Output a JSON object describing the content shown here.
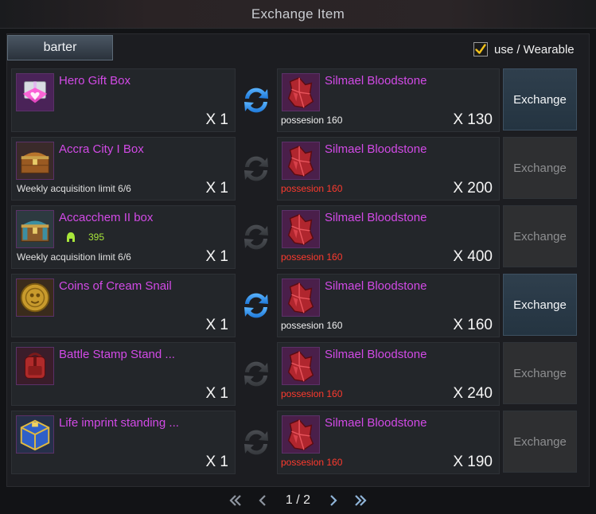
{
  "window": {
    "title": "Exchange Item"
  },
  "tab": {
    "label": "barter"
  },
  "filter": {
    "label": "use / Wearable",
    "checked": true
  },
  "colors": {
    "item_name": "#d24ae6",
    "possession_ok": "#f0f0f0",
    "possession_insufficient": "#ff3a2e",
    "bonus_value": "#a8e63a",
    "checkmark": "#f2c21b"
  },
  "rows": [
    {
      "give": {
        "name": "Hero Gift Box",
        "qty": "X 1",
        "limit": "",
        "bonus": "",
        "icon": "gift-box-icon"
      },
      "swap_active": true,
      "get": {
        "name": "Silmael Bloodstone",
        "possession": "possesion 160",
        "possession_ok": true,
        "qty": "X 130",
        "icon": "bloodstone-icon"
      },
      "button": {
        "label": "Exchange",
        "enabled": true
      }
    },
    {
      "give": {
        "name": "Accra City I Box",
        "qty": "X 1",
        "limit": "Weekly acquisition limit 6/6",
        "bonus": "",
        "icon": "treasure-chest-icon"
      },
      "swap_active": false,
      "get": {
        "name": "Silmael Bloodstone",
        "possession": "possesion 160",
        "possession_ok": false,
        "qty": "X 200",
        "icon": "bloodstone-icon"
      },
      "button": {
        "label": "Exchange",
        "enabled": false
      }
    },
    {
      "give": {
        "name": "Accacchem II box",
        "qty": "X 1",
        "limit": "Weekly acquisition limit 6/6",
        "bonus": "395",
        "icon": "teal-chest-icon"
      },
      "swap_active": false,
      "get": {
        "name": "Silmael Bloodstone",
        "possession": "possesion 160",
        "possession_ok": false,
        "qty": "X 400",
        "icon": "bloodstone-icon"
      },
      "button": {
        "label": "Exchange",
        "enabled": false
      }
    },
    {
      "give": {
        "name": "Coins of Cream Snail",
        "qty": "X 1",
        "limit": "",
        "bonus": "",
        "icon": "gold-coin-icon"
      },
      "swap_active": true,
      "get": {
        "name": "Silmael Bloodstone",
        "possession": "possesion 160",
        "possession_ok": true,
        "qty": "X 160",
        "icon": "bloodstone-icon"
      },
      "button": {
        "label": "Exchange",
        "enabled": true
      }
    },
    {
      "give": {
        "name": "Battle Stamp Stand ...",
        "qty": "X 1",
        "limit": "",
        "bonus": "",
        "icon": "backpack-icon"
      },
      "swap_active": false,
      "get": {
        "name": "Silmael Bloodstone",
        "possession": "possesion 160",
        "possession_ok": false,
        "qty": "X 240",
        "icon": "bloodstone-icon"
      },
      "button": {
        "label": "Exchange",
        "enabled": false
      }
    },
    {
      "give": {
        "name": "Life imprint standing ...",
        "qty": "X 1",
        "limit": "",
        "bonus": "",
        "icon": "blue-gold-box-icon"
      },
      "swap_active": false,
      "get": {
        "name": "Silmael Bloodstone",
        "possession": "possesion 160",
        "possession_ok": false,
        "qty": "X 190",
        "icon": "bloodstone-icon"
      },
      "button": {
        "label": "Exchange",
        "enabled": false
      }
    }
  ],
  "pagination": {
    "text": "1 / 2",
    "current": 1,
    "total": 2
  }
}
